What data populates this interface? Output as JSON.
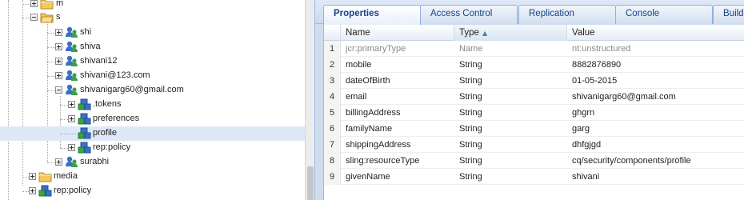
{
  "tree": {
    "items": [
      {
        "label": "m",
        "type": "folder",
        "toggle": "plus"
      },
      {
        "label": "s",
        "type": "folder",
        "toggle": "minus"
      },
      {
        "label": "shi",
        "type": "user",
        "toggle": "plus"
      },
      {
        "label": "shiva",
        "type": "user",
        "toggle": "plus"
      },
      {
        "label": "shivani12",
        "type": "user",
        "toggle": "plus"
      },
      {
        "label": "shivani@123.com",
        "type": "user",
        "toggle": "plus"
      },
      {
        "label": "shivanigarg60@gmail.com",
        "type": "user",
        "toggle": "minus"
      },
      {
        "label": ".tokens",
        "type": "node",
        "toggle": "plus"
      },
      {
        "label": "preferences",
        "type": "node",
        "toggle": "plus"
      },
      {
        "label": "profile",
        "type": "node",
        "toggle": "none",
        "selected": true
      },
      {
        "label": "rep:policy",
        "type": "node",
        "toggle": "plus"
      },
      {
        "label": "surabhi",
        "type": "user",
        "toggle": "plus"
      },
      {
        "label": "media",
        "type": "folder",
        "toggle": "plus"
      },
      {
        "label": "rep:policy",
        "type": "node",
        "toggle": "plus"
      }
    ]
  },
  "tabs": [
    {
      "label": "Properties",
      "active": true
    },
    {
      "label": "Access Control",
      "active": false
    },
    {
      "label": "Replication",
      "active": false
    },
    {
      "label": "Console",
      "active": false
    },
    {
      "label": "Build",
      "active": false
    }
  ],
  "grid": {
    "headers": {
      "name": "Name",
      "type": "Type",
      "value": "Value"
    },
    "sort_indicator": "▲",
    "rows": [
      {
        "num": "1",
        "name": "jcr:primaryType",
        "type": "Name",
        "value": "nt:unstructured",
        "dim": true
      },
      {
        "num": "2",
        "name": "mobile",
        "type": "String",
        "value": "8882876890"
      },
      {
        "num": "3",
        "name": "dateOfBirth",
        "type": "String",
        "value": "01-05-2015"
      },
      {
        "num": "4",
        "name": "email",
        "type": "String",
        "value": "shivanigarg60@gmail.com"
      },
      {
        "num": "5",
        "name": "billingAddress",
        "type": "String",
        "value": "ghgrn"
      },
      {
        "num": "6",
        "name": "familyName",
        "type": "String",
        "value": "garg"
      },
      {
        "num": "7",
        "name": "shippingAddress",
        "type": "String",
        "value": "dhfgjgd"
      },
      {
        "num": "8",
        "name": "sling:resourceType",
        "type": "String",
        "value": "cq/security/components/profile"
      },
      {
        "num": "9",
        "name": "givenName",
        "type": "String",
        "value": "shivani"
      }
    ]
  },
  "colors": {
    "selection": "#dfe8f6",
    "tab_text": "#15428b",
    "panel_bg": "#cfdcec",
    "folder": "#f5c85a",
    "user_blue": "#3a6fc7",
    "user_green": "#3aa04a"
  }
}
